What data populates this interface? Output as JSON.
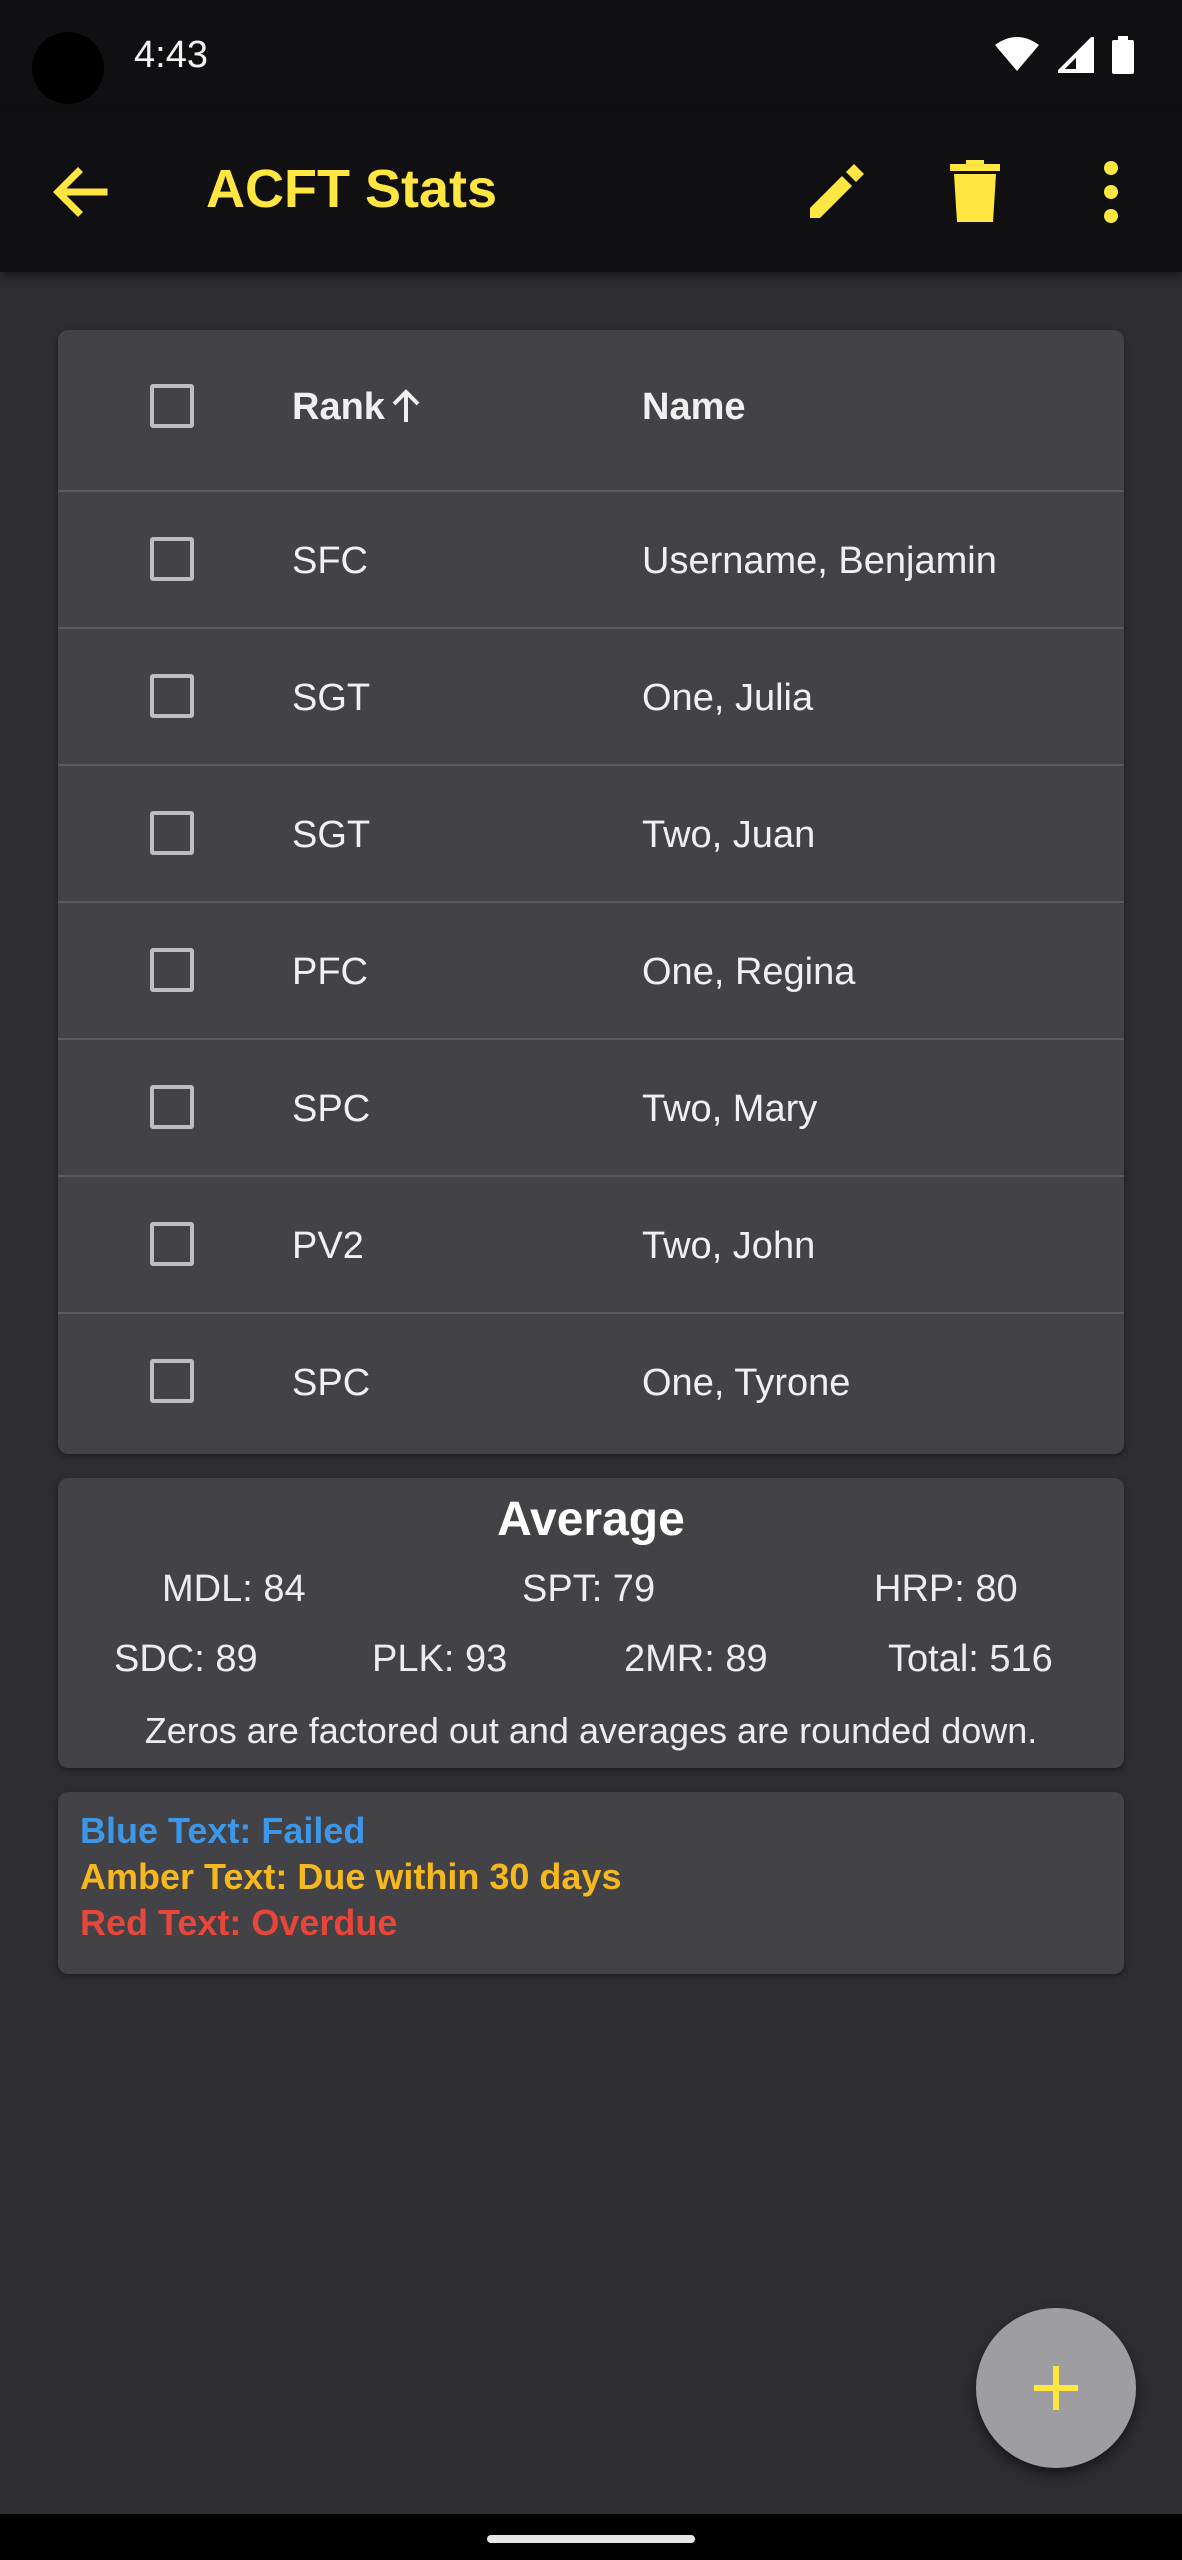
{
  "status_bar": {
    "time": "4:43",
    "icons": [
      "wifi-icon",
      "signal-icon",
      "battery-icon"
    ]
  },
  "app_bar": {
    "title": "ACFT Stats",
    "icons": [
      "back-arrow-icon",
      "pencil-icon",
      "trash-icon",
      "more-vert-icon"
    ],
    "accent_color": "#ffe640"
  },
  "table": {
    "headers": {
      "rank": "Rank",
      "name": "Name"
    },
    "sort_icon": "arrow-up-icon",
    "rows": [
      {
        "rank": "SFC",
        "name": "Username, Benjamin"
      },
      {
        "rank": "SGT",
        "name": "One, Julia"
      },
      {
        "rank": "SGT",
        "name": "Two, Juan"
      },
      {
        "rank": "PFC",
        "name": "One, Regina"
      },
      {
        "rank": "SPC",
        "name": "Two, Mary"
      },
      {
        "rank": "PV2",
        "name": "Two, John"
      },
      {
        "rank": "SPC",
        "name": "One, Tyrone"
      }
    ]
  },
  "average": {
    "title": "Average",
    "mdl": "MDL: 84",
    "spt": "SPT: 79",
    "hrp": "HRP: 80",
    "sdc": "SDC: 89",
    "plk": "PLK: 93",
    "tmr": "2MR: 89",
    "total": "Total: 516",
    "note": "Zeros are factored out and averages are rounded down."
  },
  "legend": {
    "blue": {
      "text": "Blue Text: Failed",
      "color": "#3d97e8"
    },
    "amber": {
      "text": "Amber Text: Due within 30 days",
      "color": "#f5b81e"
    },
    "red": {
      "text": "Red Text: Overdue",
      "color": "#e8463a"
    }
  },
  "fab": {
    "icon": "plus-icon"
  }
}
